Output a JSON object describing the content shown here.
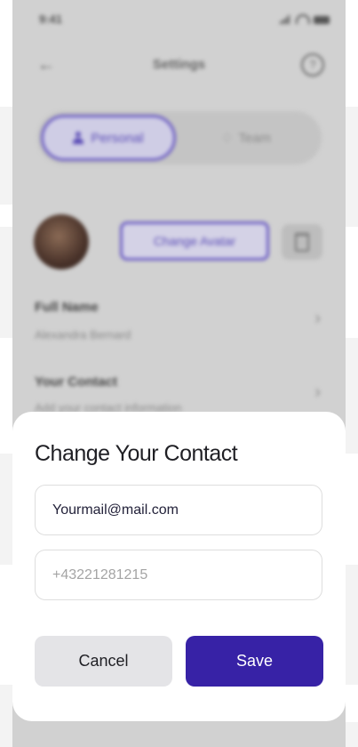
{
  "background_screen": {
    "status_time": "9:41",
    "title": "Settings",
    "tabs": [
      {
        "label": "Personal",
        "active": true
      },
      {
        "label": "Team",
        "active": false
      }
    ],
    "change_avatar_label": "Change Avatar",
    "rows": [
      {
        "label": "Full Name",
        "value": "Alexandra Bernard"
      },
      {
        "label": "Your Contact",
        "value": "Add your contact information"
      }
    ]
  },
  "sheet": {
    "title": "Change Your Contact",
    "email_value": "Yourmail@mail.com",
    "phone_placeholder": "+43221281215",
    "cancel_label": "Cancel",
    "save_label": "Save"
  },
  "colors": {
    "accent": "#3722a6",
    "overlay": "#d1d1d1",
    "cancel_bg": "#e4e4e7"
  },
  "icons": [
    "back-arrow-icon",
    "help-icon",
    "person-icon",
    "team-icon",
    "trash-icon",
    "chevron-right-icon"
  ]
}
